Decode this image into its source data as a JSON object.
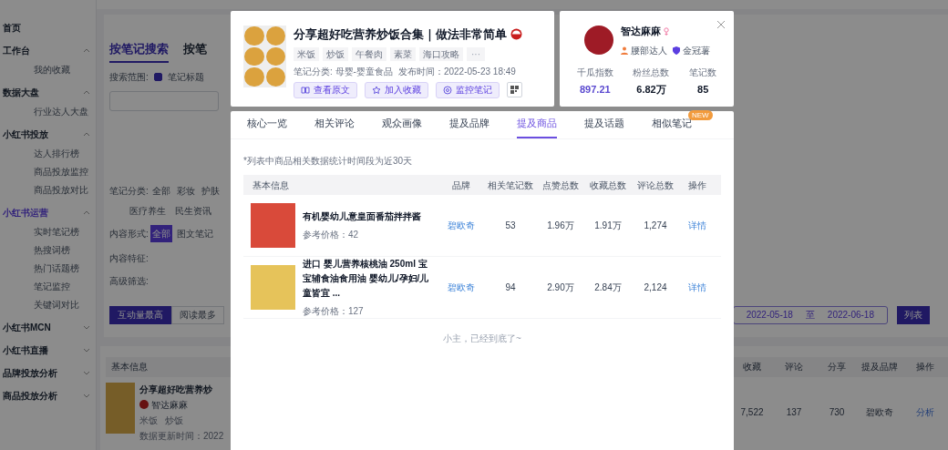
{
  "sidebar": [
    {
      "label": "首页",
      "selected": false
    },
    {
      "label": "工作台",
      "expanded": true,
      "selected": false,
      "items": [
        "我的收藏"
      ]
    },
    {
      "label": "数据大盘",
      "expanded": true,
      "selected": false,
      "items": [
        "行业达人大盘"
      ]
    },
    {
      "label": "小红书投放",
      "expanded": true,
      "selected": false,
      "items": [
        "达人排行榜",
        "商品投放监控",
        "商品投放对比"
      ]
    },
    {
      "label": "小红书运营",
      "expanded": true,
      "selected": true,
      "items": [
        "实时笔记榜",
        "热搜词榜",
        "热门话题榜",
        "笔记监控",
        "关键词对比"
      ]
    },
    {
      "label": "小红书MCN",
      "expanded": false,
      "selected": false
    },
    {
      "label": "小红书直播",
      "expanded": false,
      "selected": false
    },
    {
      "label": "品牌投放分析",
      "expanded": false,
      "selected": false
    },
    {
      "label": "商品投放分析",
      "expanded": false,
      "selected": false
    }
  ],
  "search": {
    "tabs": [
      {
        "label": "按笔记搜索",
        "selected": true
      },
      {
        "label": "按笔",
        "selected": false
      }
    ],
    "scope_label": "搜索范围:",
    "scope_checked": true,
    "scope_option": "笔记标题",
    "filters": [
      {
        "label": "笔记分类:",
        "options": [
          {
            "label": "全部",
            "selected": false
          },
          {
            "label": "彩妆",
            "selected": false
          },
          {
            "label": "护肤",
            "selected": false
          }
        ],
        "more": [
          "医疗养生",
          "民生资讯"
        ]
      },
      {
        "label": "内容形式:",
        "options": [
          {
            "label": "全部",
            "selected": true
          },
          {
            "label": "图文笔记",
            "selected": false
          }
        ]
      },
      {
        "label": "内容特征:"
      },
      {
        "label": "高级筛选:"
      }
    ],
    "sorts": [
      {
        "label": "互动量最高",
        "selected": true
      },
      {
        "label": "阅读最多",
        "selected": false
      }
    ],
    "date_from": "2022-05-18",
    "date_sep": "至",
    "date_to": "2022-06-18",
    "view_button": "列表"
  },
  "results": {
    "left_header": "基本信息",
    "columns": [
      "收藏",
      "评论",
      "分享",
      "提及品牌",
      "操作"
    ],
    "row": {
      "title": "分享超好吃营养炒",
      "author": "智达麻麻",
      "tags": [
        "米饭",
        "炒饭"
      ],
      "updated": "数据更新时间：2022",
      "values": [
        "7,522",
        "137",
        "730",
        "碧欧奇"
      ],
      "action": "分析"
    }
  },
  "note": {
    "title": "分享超好吃营养炒饭合集｜做法非常简单",
    "tags": [
      "米饭",
      "炒饭",
      "午餐肉",
      "素菜",
      "海口攻略"
    ],
    "more": "···",
    "category": "笔记分类: 母婴-婴童食品",
    "published": "发布时间：2022-05-23 18:49",
    "actions": [
      {
        "kind": "book",
        "label": "查看原文"
      },
      {
        "kind": "star",
        "label": "加入收藏"
      },
      {
        "kind": "monitor",
        "label": "监控笔记"
      }
    ]
  },
  "profile": {
    "name": "智达麻麻",
    "badges": [
      {
        "kind": "tier",
        "label": "腰部达人"
      },
      {
        "kind": "crown",
        "label": "金冠薯"
      }
    ],
    "stats": [
      {
        "label": "千瓜指数",
        "value": "897.21",
        "highlight": true
      },
      {
        "label": "粉丝总数",
        "value": "6.82万",
        "highlight": false
      },
      {
        "label": "笔记数",
        "value": "85",
        "highlight": false
      }
    ]
  },
  "tabs": [
    {
      "label": "核心一览",
      "selected": false
    },
    {
      "label": "相关评论",
      "selected": false
    },
    {
      "label": "观众画像",
      "selected": false
    },
    {
      "label": "提及品牌",
      "selected": false
    },
    {
      "label": "提及商品",
      "selected": true
    },
    {
      "label": "提及话题",
      "selected": false
    },
    {
      "label": "相似笔记",
      "selected": false,
      "badge": "NEW"
    }
  ],
  "hint": "*列表中商品相关数据统计时间段为近30天",
  "table": {
    "columns": [
      "基本信息",
      "品牌",
      "相关笔记数",
      "点赞总数",
      "收藏总数",
      "评论总数",
      "操作"
    ],
    "rows": [
      {
        "kind": "sauce",
        "name": "有机婴幼儿意皇面番茄拌拌酱",
        "price": "参考价格：42",
        "brand": "碧欧奇",
        "notes": "53",
        "likes": "1.96万",
        "saves": "1.91万",
        "comments": "1,274",
        "action": "详情"
      },
      {
        "kind": "oil",
        "name": "进口 婴儿营养核桃油 250ml 宝宝辅食油食用油 婴幼儿/孕妇/儿童皆宜 ...",
        "price": "参考价格：127",
        "brand": "碧欧奇",
        "notes": "94",
        "likes": "2.90万",
        "saves": "2.84万",
        "comments": "2,124",
        "action": "详情"
      }
    ]
  },
  "footer": "小主，已经到底了~"
}
